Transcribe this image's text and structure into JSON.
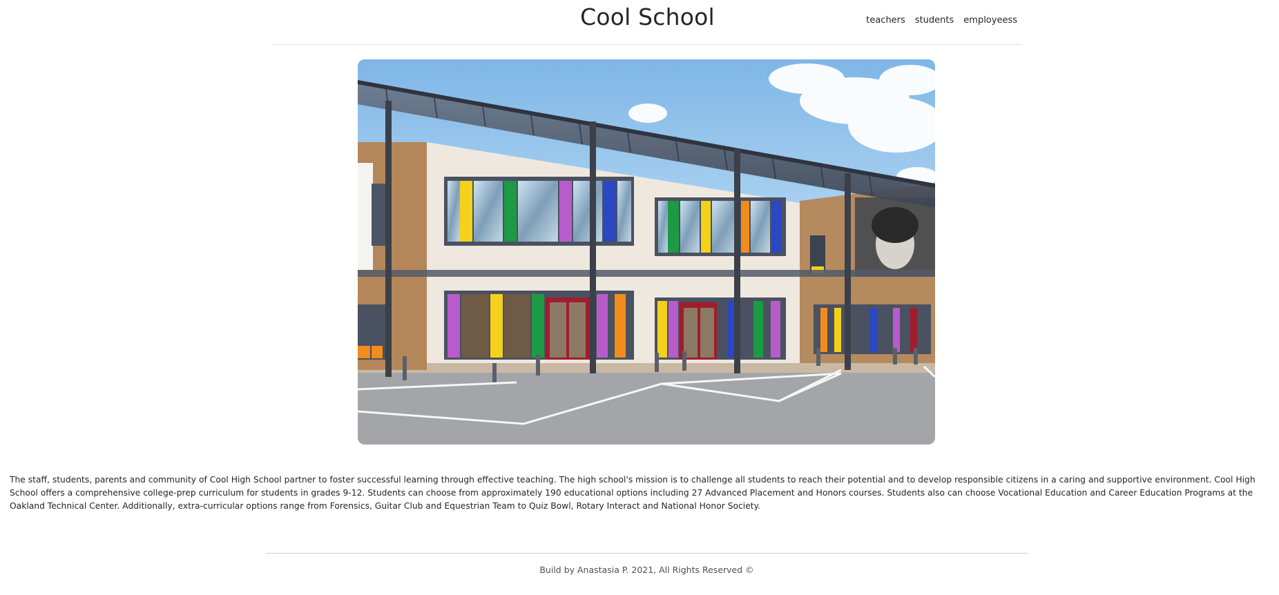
{
  "header": {
    "title": "Cool School",
    "nav": [
      {
        "label": "teachers"
      },
      {
        "label": "students"
      },
      {
        "label": "employeess"
      }
    ]
  },
  "hero": {
    "icon": "school-building-photo",
    "colors": {
      "sky": "#8fc3ec",
      "wall": "#efe9e1",
      "brick": "#b98a5c",
      "canopy": "#3f4654",
      "asphalt": "#9a9c9f",
      "panel_yellow": "#f4d11a",
      "panel_green": "#1c9a44",
      "panel_purple": "#b85ccc",
      "panel_blue": "#2b47c4",
      "panel_orange": "#f28c1c",
      "door_red": "#a01d2c"
    }
  },
  "about": {
    "text": "The staff, students, parents and community of Cool High School partner to foster successful learning through effective teaching. The high school's mission is to challenge all students to reach their potential and to develop responsible citizens in a caring and supportive environment. Cool High School offers a comprehensive college-prep curriculum for students in grades 9-12. Students can choose from approximately 190 educational options including 27 Advanced Placement and Honors courses. Students also can choose Vocational Education and Career Education Programs at the Oakland Technical Center. Additionally, extra-curricular options range from Forensics, Guitar Club and Equestrian Team to Quiz Bowl, Rotary Interact and National Honor Society."
  },
  "footer": {
    "text": "Build by Anastasia P. 2021, All Rights Reserved ©"
  }
}
